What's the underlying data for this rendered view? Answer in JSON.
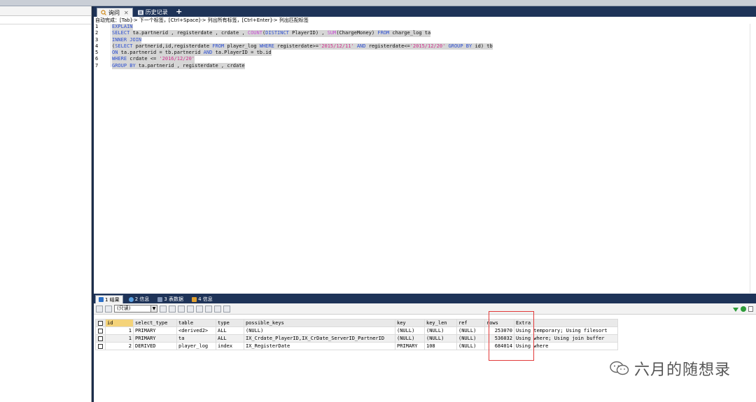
{
  "editor": {
    "tabs": [
      {
        "label": "询问",
        "active": true
      },
      {
        "label": "历史记录",
        "active": false
      }
    ],
    "hint": "自动完成：[Tab]-> 下一个标签，[Ctrl+Space]-> 列出所有标签，[Ctrl+Enter]-> 列出匹配标签",
    "lines": [
      {
        "n": "1",
        "parts": [
          {
            "t": "EXPLAIN",
            "c": "kw"
          }
        ]
      },
      {
        "n": "2",
        "parts": [
          {
            "t": "SELECT",
            "c": "kw"
          },
          {
            "t": " ta.partnerid , registerdate , crdate , ",
            "c": ""
          },
          {
            "t": "COUNT",
            "c": "fn"
          },
          {
            "t": "(",
            "c": ""
          },
          {
            "t": "DISTINCT",
            "c": "kw"
          },
          {
            "t": " PlayerID) , ",
            "c": ""
          },
          {
            "t": "SUM",
            "c": "fn"
          },
          {
            "t": "(ChargeMoney) ",
            "c": ""
          },
          {
            "t": "FROM",
            "c": "kw"
          },
          {
            "t": " charge_log ta",
            "c": ""
          }
        ]
      },
      {
        "n": "3",
        "parts": [
          {
            "t": "INNER JOIN",
            "c": "kw"
          }
        ]
      },
      {
        "n": "4",
        "parts": [
          {
            "t": "(",
            "c": ""
          },
          {
            "t": "SELECT",
            "c": "kw"
          },
          {
            "t": " partnerid,id,registerdate ",
            "c": ""
          },
          {
            "t": "FROM",
            "c": "kw"
          },
          {
            "t": " player_log ",
            "c": ""
          },
          {
            "t": "WHERE",
            "c": "kw"
          },
          {
            "t": " registerdate>=",
            "c": ""
          },
          {
            "t": "'2015/12/11'",
            "c": "str"
          },
          {
            "t": " ",
            "c": ""
          },
          {
            "t": "AND",
            "c": "kw"
          },
          {
            "t": " registerdate<=",
            "c": ""
          },
          {
            "t": "'2015/12/20'",
            "c": "str"
          },
          {
            "t": " ",
            "c": ""
          },
          {
            "t": "GROUP BY",
            "c": "kw"
          },
          {
            "t": " id) tb",
            "c": ""
          }
        ]
      },
      {
        "n": "5",
        "parts": [
          {
            "t": "ON",
            "c": "kw"
          },
          {
            "t": " ta.partnerid = tb.partnerid ",
            "c": ""
          },
          {
            "t": "AND",
            "c": "kw"
          },
          {
            "t": " ta.PlayerID = tb.id",
            "c": ""
          }
        ]
      },
      {
        "n": "6",
        "parts": [
          {
            "t": "WHERE",
            "c": "kw"
          },
          {
            "t": " crdate <= ",
            "c": ""
          },
          {
            "t": "'2016/12/20'",
            "c": "str"
          }
        ]
      },
      {
        "n": "7",
        "parts": [
          {
            "t": "GROUP BY",
            "c": "kw"
          },
          {
            "t": " ta.partnerid , registerdate , crdate",
            "c": ""
          }
        ]
      }
    ]
  },
  "results": {
    "tabs": [
      {
        "label": "1 结果",
        "active": true,
        "color": "#2b6fc7"
      },
      {
        "label": "2 信息",
        "active": false,
        "color": "#5aa0e0"
      },
      {
        "label": "3 表数据",
        "active": false,
        "color": "#7f93b5"
      },
      {
        "label": "4 信息",
        "active": false,
        "color": "#e0a030"
      }
    ],
    "mode_select": "(只读)",
    "columns": [
      "id",
      "select_type",
      "table",
      "type",
      "possible_keys",
      "key",
      "key_len",
      "ref",
      "rows",
      "Extra"
    ],
    "rows": [
      [
        "1",
        "PRIMARY",
        "<derived2>",
        "ALL",
        "(NULL)",
        "(NULL)",
        "(NULL)",
        "(NULL)",
        "253070",
        "Using temporary; Using filesort"
      ],
      [
        "1",
        "PRIMARY",
        "ta",
        "ALL",
        "IX_Crdate_PlayerID,IX_CrDate_ServerID_PartnerID",
        "(NULL)",
        "(NULL)",
        "(NULL)",
        "536032",
        "Using where; Using join buffer"
      ],
      [
        "2",
        "DERIVED",
        "player_log",
        "index",
        "IX_RegisterDate",
        "PRIMARY",
        "108",
        "(NULL)",
        "684014",
        "Using where"
      ]
    ]
  },
  "watermark": {
    "text": "六月的随想录"
  },
  "colors": {
    "accent_dark": "#1e3358",
    "highlight_box": "#e23a3a",
    "keyword": "#2b4ed1",
    "string": "#d12f8c",
    "function": "#c54bd1"
  }
}
